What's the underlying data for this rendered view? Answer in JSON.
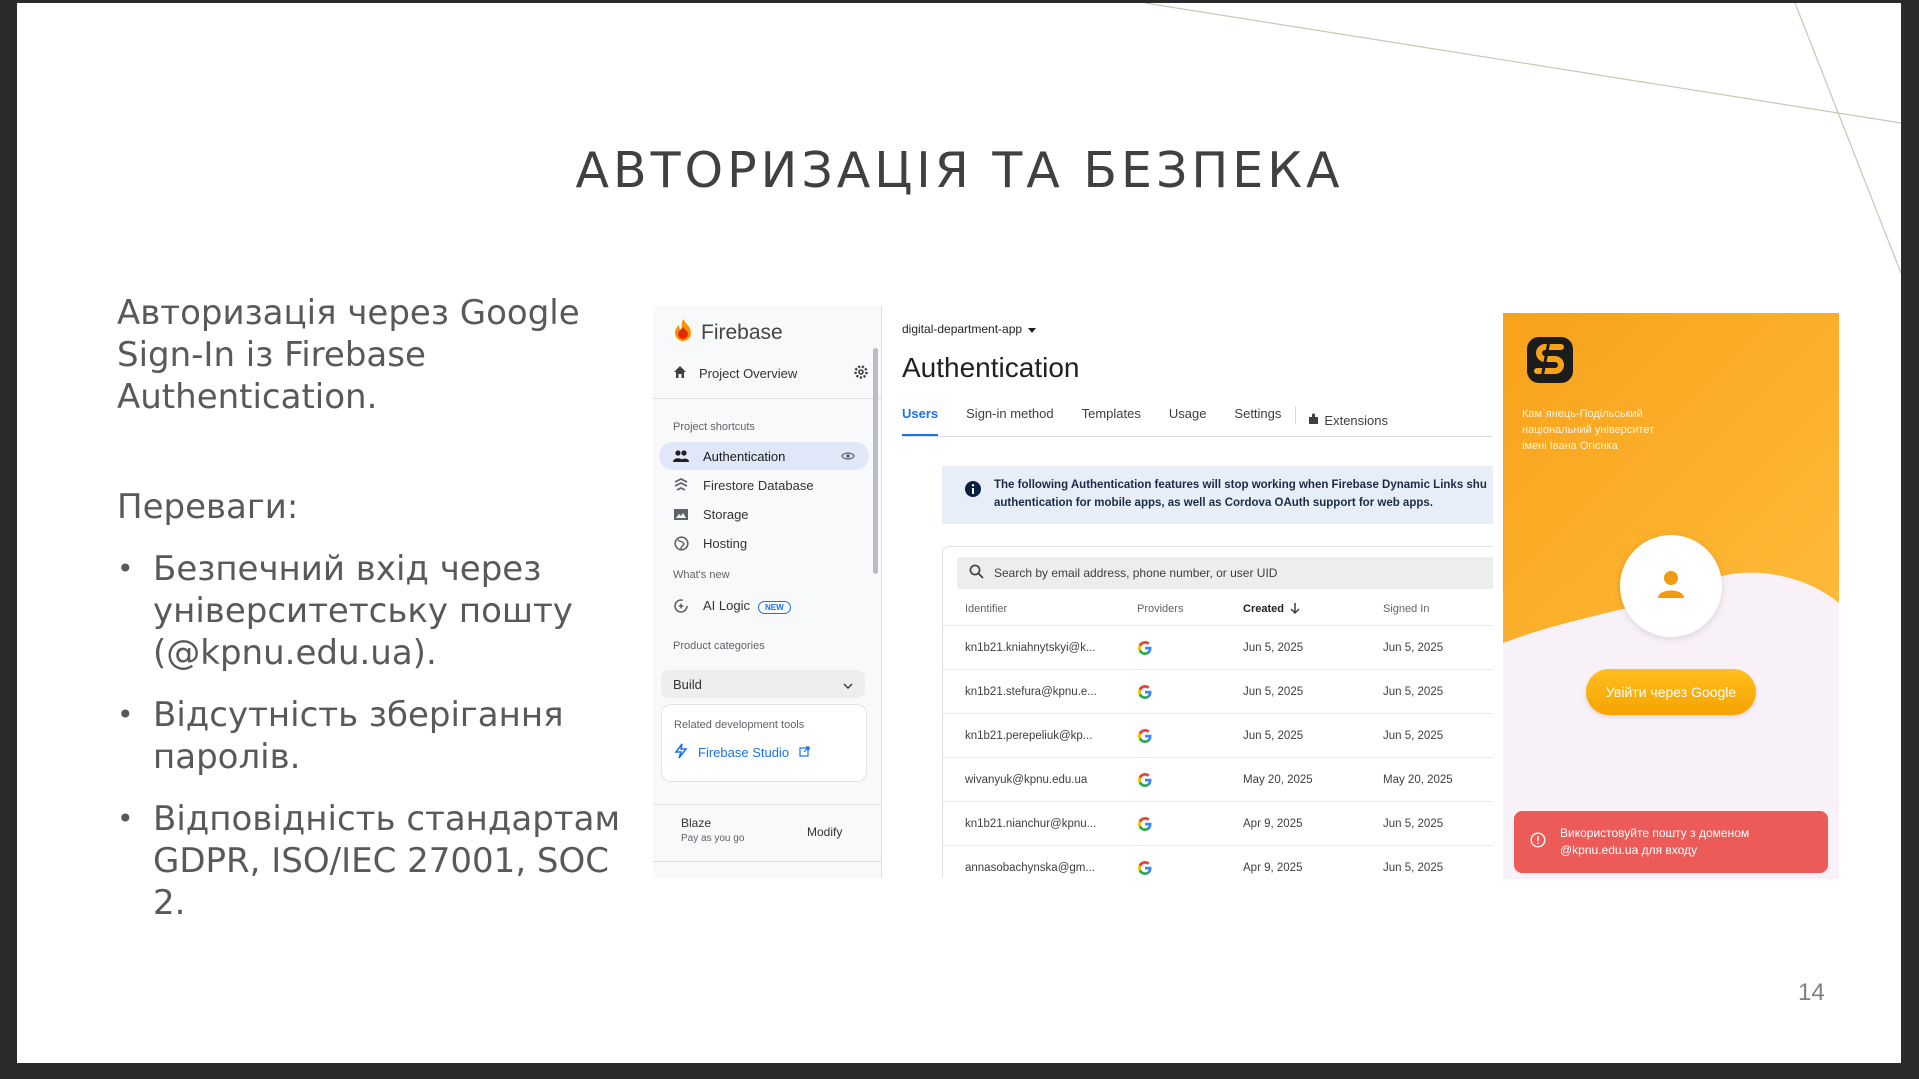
{
  "slide": {
    "title": "АВТОРИЗАЦІЯ ТА БЕЗПЕКА",
    "intro": "Авторизація через Google Sign-In із Firebase Authentication.",
    "advantages_heading": "Переваги:",
    "bullets": [
      "Безпечний вхід через університетську пошту (@kpnu.edu.ua).",
      "Відсутність зберігання паролів.",
      "Відповідність стандартам GDPR, ISO/IEC 27001, SOC 2."
    ],
    "page_number": "14"
  },
  "firebase": {
    "logo": "Firebase",
    "project_overview": "Project Overview",
    "project_shortcuts": "Project shortcuts",
    "nav": [
      {
        "label": "Authentication",
        "icon": "people-icon"
      },
      {
        "label": "Firestore Database",
        "icon": "firestore-icon"
      },
      {
        "label": "Storage",
        "icon": "storage-icon"
      },
      {
        "label": "Hosting",
        "icon": "globe-icon"
      }
    ],
    "whats_new": "What's new",
    "ai_logic": "AI Logic",
    "new_badge": "NEW",
    "product_categories": "Product categories",
    "build": "Build",
    "related_tools": "Related development tools",
    "firebase_studio": "Firebase Studio",
    "plan": "Blaze",
    "plan_sub": "Pay as you go",
    "modify": "Modify",
    "project_name": "digital-department-app",
    "page_title": "Authentication",
    "tabs": [
      "Users",
      "Sign-in method",
      "Templates",
      "Usage",
      "Settings",
      "Extensions"
    ],
    "notice_line1": "The following Authentication features will stop working when Firebase Dynamic Links shu",
    "notice_line2": "authentication for mobile apps, as well as Cordova OAuth support for web apps.",
    "search_placeholder": "Search by email address, phone number, or user UID",
    "columns": [
      "Identifier",
      "Providers",
      "Created",
      "Signed In"
    ],
    "rows": [
      {
        "identifier": "kn1b21.kniahnytskyi@k...",
        "created": "Jun 5, 2025",
        "signed_in": "Jun 5, 2025"
      },
      {
        "identifier": "kn1b21.stefura@kpnu.e...",
        "created": "Jun 5, 2025",
        "signed_in": "Jun 5, 2025"
      },
      {
        "identifier": "kn1b21.perepeliuk@kp...",
        "created": "Jun 5, 2025",
        "signed_in": "Jun 5, 2025"
      },
      {
        "identifier": "wivanyuk@kpnu.edu.ua",
        "created": "May 20, 2025",
        "signed_in": "May 20, 2025"
      },
      {
        "identifier": "kn1b21.nianchur@kpnu...",
        "created": "Apr 9, 2025",
        "signed_in": "Jun 5, 2025"
      },
      {
        "identifier": "annasobachynska@gm...",
        "created": "Apr 9, 2025",
        "signed_in": "Jun 5, 2025"
      }
    ]
  },
  "app": {
    "university_line1": "Кам`янець-Подільський",
    "university_line2": "національний університет",
    "university_line3": "імені Івана Огієнка",
    "google_button": "Увійти через Google",
    "error_line1": "Використовуйте пошту з доменом",
    "error_line2": "@kpnu.edu.ua для входу"
  },
  "colors": {
    "accent_blue": "#1a73e8",
    "app_orange": "#f7a21b",
    "error_red": "#ec5b57"
  }
}
